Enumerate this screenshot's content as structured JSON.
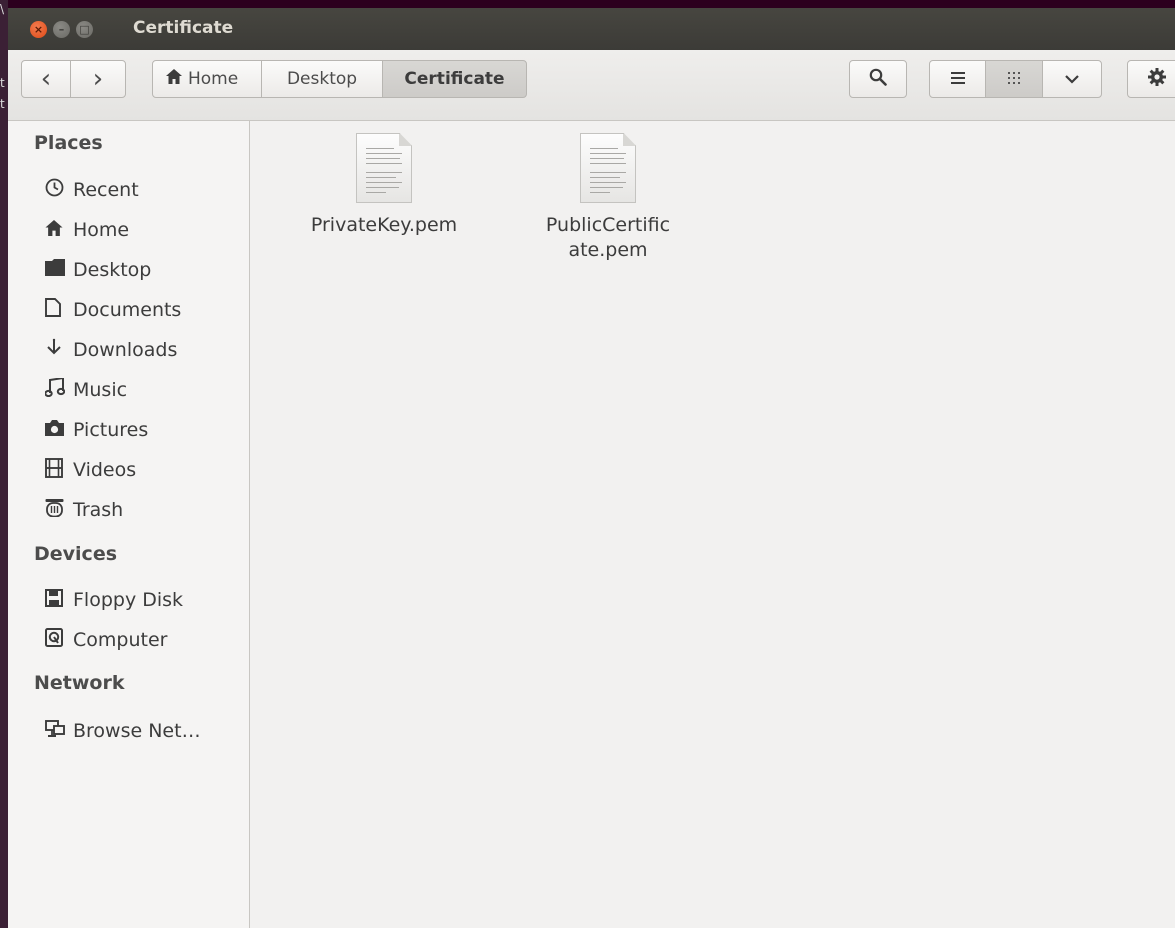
{
  "window": {
    "title": "Certificate",
    "close_symbol": "×",
    "minimize_symbol": "–",
    "maximize_symbol": "□"
  },
  "desktop_edge": {
    "glyphs": [
      "\\",
      "t",
      "t"
    ]
  },
  "toolbar": {
    "back_icon": "‹",
    "forward_icon": "›",
    "breadcrumb": {
      "home_icon": "home-icon",
      "home_label": "Home",
      "desktop_label": "Desktop",
      "current_label": "Certificate"
    },
    "search_icon": "search-icon",
    "view_list_icon": "list-view-icon",
    "view_grid_icon": "grid-view-icon",
    "view_menu_icon": "chevron-down-icon",
    "settings_icon": "gear-icon"
  },
  "sidebar": {
    "places_heading": "Places",
    "places": [
      {
        "label": "Recent",
        "icon": "clock-icon"
      },
      {
        "label": "Home",
        "icon": "home-icon"
      },
      {
        "label": "Desktop",
        "icon": "folder-icon"
      },
      {
        "label": "Documents",
        "icon": "document-icon"
      },
      {
        "label": "Downloads",
        "icon": "download-icon"
      },
      {
        "label": "Music",
        "icon": "music-icon"
      },
      {
        "label": "Pictures",
        "icon": "camera-icon"
      },
      {
        "label": "Videos",
        "icon": "film-icon"
      },
      {
        "label": "Trash",
        "icon": "trash-icon"
      }
    ],
    "devices_heading": "Devices",
    "devices": [
      {
        "label": "Floppy Disk",
        "icon": "floppy-icon"
      },
      {
        "label": "Computer",
        "icon": "harddisk-icon"
      }
    ],
    "network_heading": "Network",
    "network": [
      {
        "label": "Browse Net…",
        "icon": "network-icon"
      }
    ]
  },
  "files": [
    {
      "name": "PrivateKey.pem",
      "icon": "text-file-icon"
    },
    {
      "name": "PublicCertificate.pem",
      "icon": "text-file-icon"
    }
  ]
}
